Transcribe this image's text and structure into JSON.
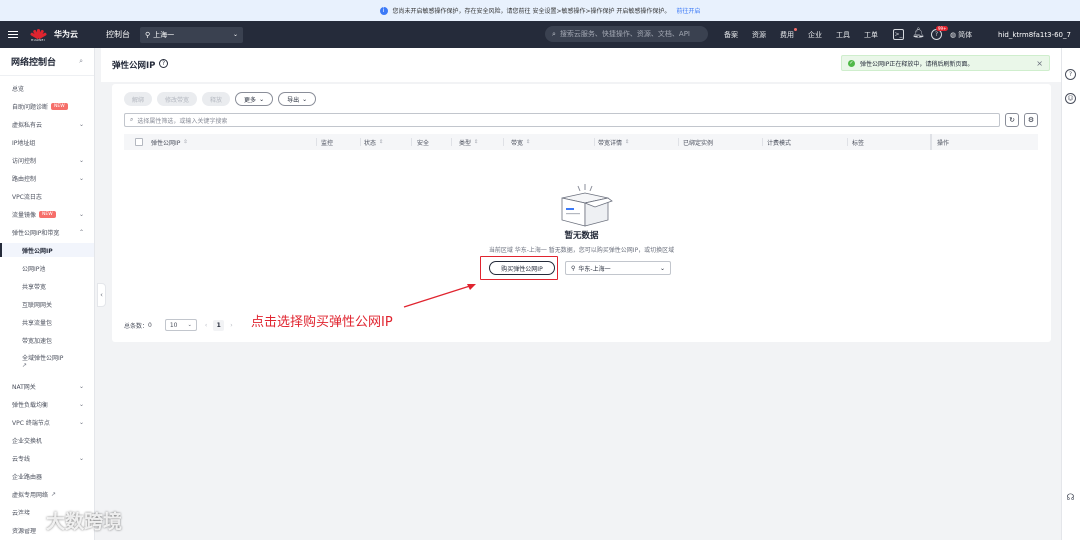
{
  "notice": {
    "text": "您尚未开启敏感操作保护，存在安全风险，请您前往 安全设置>敏感操作>操作保护 开启敏感操作保护。",
    "link": "前往开启"
  },
  "topbar": {
    "logo_text": "HUAWEI",
    "brand": "华为云",
    "console": "控制台",
    "region": "上海一",
    "search_placeholder": "搜索云服务、快捷操作、资源、文档、API",
    "nav": [
      "备案",
      "资源",
      "费用",
      "企业",
      "工具",
      "工单"
    ],
    "notification_count": "99+",
    "language": "简体",
    "account": "hid_ktrm8fa1t3-60_7"
  },
  "sidebar": {
    "title": "网络控制台",
    "items": [
      {
        "label": "总览"
      },
      {
        "label": "自助问题诊断",
        "badge": "NEW"
      },
      {
        "label": "虚拟私有云"
      },
      {
        "label": "IP地址组"
      },
      {
        "label": "访问控制"
      },
      {
        "label": "路由控制"
      },
      {
        "label": "VPC流日志"
      },
      {
        "label": "流量镜像",
        "badge": "NEW"
      },
      {
        "label": "弹性公网IP和带宽"
      },
      {
        "label": "弹性公网IP"
      },
      {
        "label": "公网IP池"
      },
      {
        "label": "共享带宽"
      },
      {
        "label": "互联网网关"
      },
      {
        "label": "共享流量包"
      },
      {
        "label": "带宽加速包"
      },
      {
        "label": "全域弹性公网IP"
      },
      {
        "label": "NAT网关"
      },
      {
        "label": "弹性负载均衡"
      },
      {
        "label": "VPC 终端节点"
      },
      {
        "label": "企业交换机"
      },
      {
        "label": "云专线"
      },
      {
        "label": "企业路由器"
      },
      {
        "label": "虚拟专用网络"
      },
      {
        "label": "云连接"
      },
      {
        "label": "资源管理"
      }
    ]
  },
  "page": {
    "title": "弹性公网IP",
    "toast": "弹性公网IP正在释放中，请稍后刷新页面。",
    "toolbar": [
      "解绑",
      "修改带宽",
      "释放",
      "更多",
      "导出"
    ],
    "filter_placeholder": "选择属性筛选，或输入关键字搜索",
    "columns": [
      "弹性公网IP",
      "监控",
      "状态",
      "安全",
      "类型",
      "带宽",
      "带宽详情",
      "已绑定实例",
      "计费模式",
      "标签",
      "操作"
    ],
    "empty_title": "暂无数据",
    "empty_desc": "当前区域 华东-上海一 暂无数据，您可以购买弹性公网IP，或切换区域",
    "buy_button": "购买弹性公网IP",
    "region_select": "华东-上海一",
    "total_label": "总条数：",
    "total_count": "0",
    "page_size": "10",
    "current_page": "1"
  },
  "annotation": "点击选择购买弹性公网IP",
  "watermark": "大数跨境",
  "colors": {
    "accent_red": "#e0242f",
    "header_bg": "#252b3a",
    "success": "#50b948"
  }
}
